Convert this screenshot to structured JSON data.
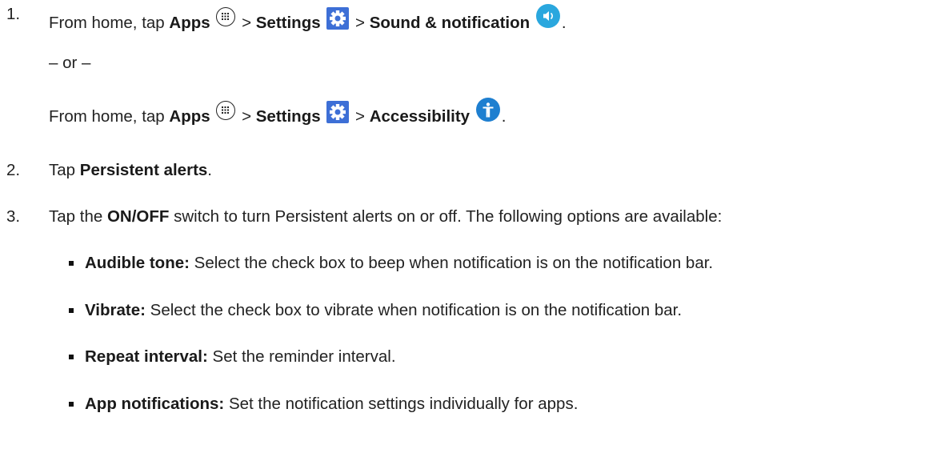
{
  "step1": {
    "number": "1.",
    "prefix": "From home, tap",
    "apps": "Apps",
    "sep1": ">",
    "settings": "Settings",
    "sep2": ">",
    "sound": "Sound & notification",
    "end": "."
  },
  "or_text": "– or –",
  "alt": {
    "prefix": "From home, tap",
    "apps": "Apps",
    "sep1": ">",
    "settings": "Settings",
    "sep2": ">",
    "accessibility": "Accessibility",
    "end": "."
  },
  "step2": {
    "number": "2.",
    "prefix": "Tap",
    "bold": "Persistent alerts",
    "end": "."
  },
  "step3": {
    "number": "3.",
    "prefix": "Tap the",
    "bold": "ON/OFF",
    "rest": "switch to turn Persistent alerts on or off. The following options are available:"
  },
  "options": [
    {
      "term": "Audible tone:",
      "desc": "Select the check box to beep when notification is on the notification bar."
    },
    {
      "term": "Vibrate:",
      "desc": "Select the check box to vibrate when notification is on the notification bar."
    },
    {
      "term": "Repeat interval:",
      "desc": "Set the reminder interval."
    },
    {
      "term": "App notifications:",
      "desc": "Set the notification settings individually for apps."
    }
  ],
  "icons": {
    "apps": "apps-icon",
    "settings": "settings-gear-icon",
    "sound": "sound-notification-icon",
    "accessibility": "accessibility-icon"
  },
  "colors": {
    "settings_bg": "#3d6fd6",
    "sound_bg": "#2aa7de",
    "accessibility_bg": "#1e7fd0"
  }
}
